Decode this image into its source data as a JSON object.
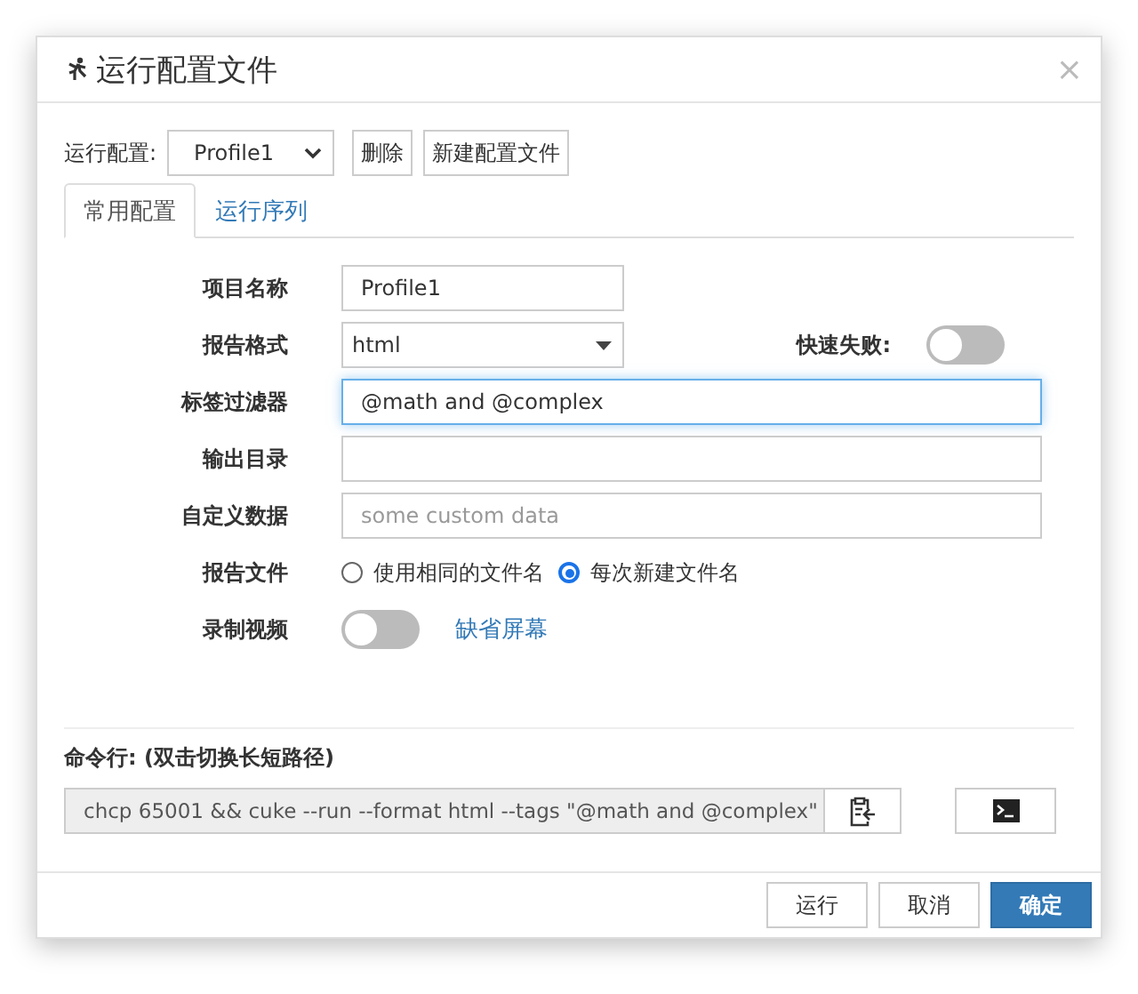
{
  "window": {
    "title": "运行配置文件",
    "close": "×"
  },
  "profile_bar": {
    "label": "运行配置:",
    "value": "Profile1",
    "buttons": [
      "删除",
      "新建配置文件"
    ]
  },
  "tabs": [
    {
      "label": "常用配置",
      "selected": true
    },
    {
      "label": "运行序列",
      "selected": false
    }
  ],
  "form": {
    "rows": [
      {
        "kind": "text",
        "label": "项目名称",
        "value": "Profile1",
        "wide": false,
        "focused": false
      },
      {
        "kind": "select",
        "label": "报告格式",
        "value": "html",
        "side_label": "快速失败:",
        "side_on": false
      },
      {
        "kind": "text",
        "label": "标签过滤器",
        "value": "@math and @complex",
        "wide": true,
        "focused": true
      },
      {
        "kind": "text",
        "label": "输出目录",
        "wide": true,
        "focused": false
      },
      {
        "kind": "text",
        "label": "自定义数据",
        "placeholder": "some custom data",
        "wide": true,
        "focused": false
      },
      {
        "kind": "radio",
        "label": "报告文件",
        "options": [
          {
            "label": "使用相同的文件名",
            "selected": false
          },
          {
            "label": "每次新建文件名",
            "selected": true
          }
        ]
      },
      {
        "kind": "toggle",
        "label": "录制视频",
        "on": false,
        "link": "缺省屏幕"
      }
    ]
  },
  "command": {
    "label": "命令行: (双击切换长短路径)",
    "value": "chcp 65001 && cuke --run --format html --tags \"@math and @complex\""
  },
  "footer": {
    "buttons": [
      {
        "label": "运行",
        "primary": false
      },
      {
        "label": "取消",
        "primary": false
      },
      {
        "label": "确定",
        "primary": true
      }
    ]
  }
}
